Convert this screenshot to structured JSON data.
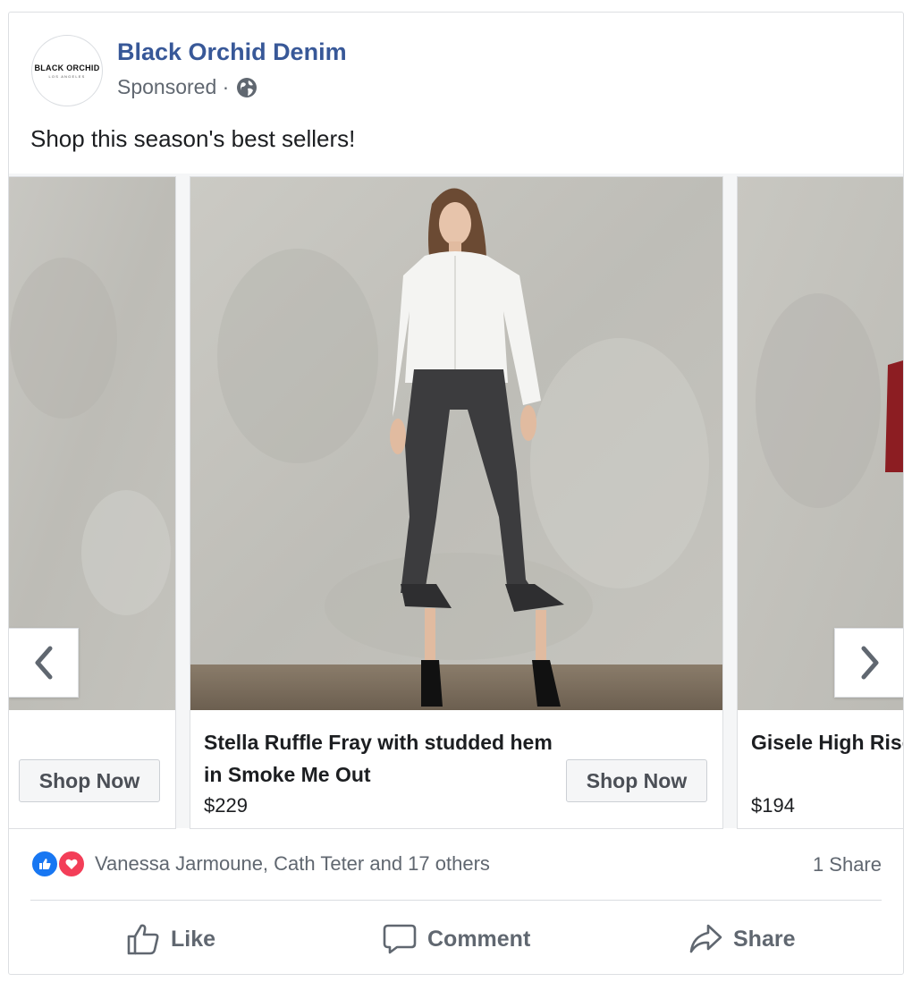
{
  "post": {
    "page_name": "Black Orchid Denim",
    "sponsored": "Sponsored ·",
    "caption": "Shop this season's best sellers!",
    "avatar": {
      "brand": "BLACK ORCHID",
      "location": "LOS ANGELES"
    }
  },
  "carousel": {
    "prev_icon": "chevron-left-icon",
    "next_icon": "chevron-right-icon",
    "cards": [
      {
        "title": "",
        "price": "",
        "button": "Shop Now"
      },
      {
        "title": "Stella Ruffle Fray with studded hem in Smoke Me Out",
        "price": "$229",
        "button": "Shop Now"
      },
      {
        "title": "Gisele High Rise piping in Gilded",
        "price": "$194",
        "button": ""
      }
    ]
  },
  "engagement": {
    "reactors": "Vanessa Jarmoune, Cath Teter and 17 others",
    "shares": "1 Share",
    "reaction_icons": [
      "like-reaction-icon",
      "love-reaction-icon"
    ]
  },
  "actions": {
    "like": "Like",
    "comment": "Comment",
    "share": "Share"
  },
  "colors": {
    "page_name": "#385898",
    "secondary_text": "#606770",
    "like_blue": "#1877f2",
    "love_red": "#f33e58",
    "border": "#dddfe2"
  }
}
